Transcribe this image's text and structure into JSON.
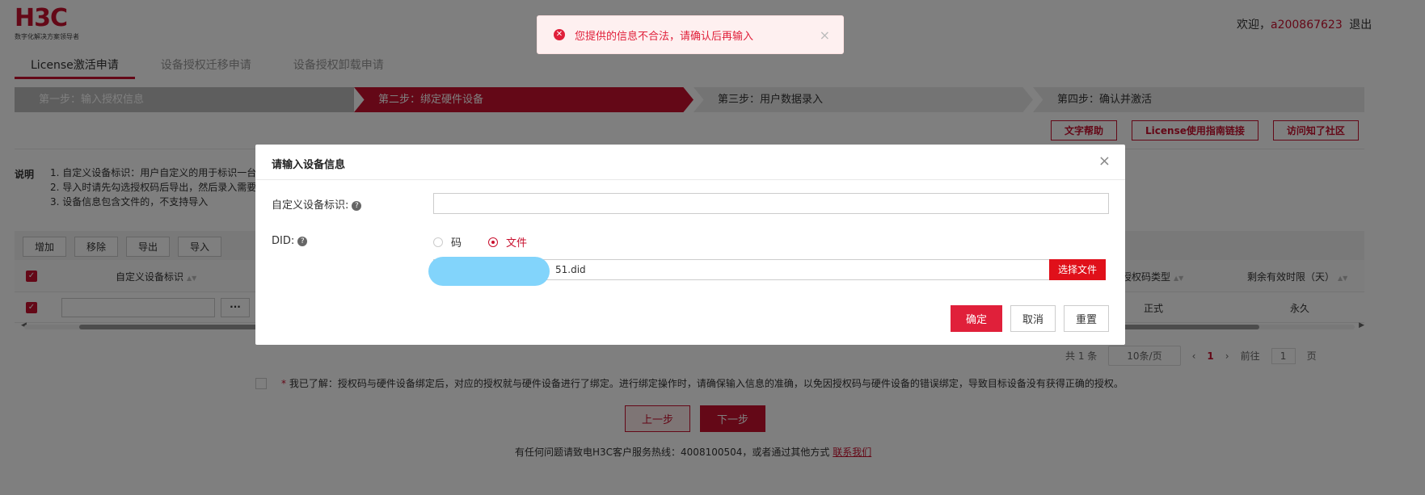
{
  "header": {
    "logo_text": "H3C",
    "logo_subtitle": "数字化解决方案领导者",
    "welcome_prefix": "欢迎，",
    "username": "a200867623",
    "logout": "退出"
  },
  "tabs": [
    {
      "label": "License激活申请",
      "active": true
    },
    {
      "label": "设备授权迁移申请",
      "active": false
    },
    {
      "label": "设备授权卸载申请",
      "active": false
    }
  ],
  "steps": [
    {
      "label": "第一步：输入授权信息"
    },
    {
      "label": "第二步：绑定硬件设备"
    },
    {
      "label": "第三步：用户数据录入"
    },
    {
      "label": "第四步：确认并激活"
    }
  ],
  "help_buttons": [
    "文字帮助",
    "License使用指南链接",
    "访问知了社区"
  ],
  "notes": {
    "label": "说明",
    "lines": [
      "1. 自定义设备标识：用户自定义的用于标识一台",
      "2. 导入时请先勾选授权码后导出，然后录入需要",
      "3. 设备信息包含文件的，不支持导入"
    ]
  },
  "toolbar": [
    "增加",
    "移除",
    "导出",
    "导入"
  ],
  "table": {
    "headers": {
      "custom_id": "自定义设备标识",
      "license_type": "授权码类型",
      "remaining": "剩余有效时限（天）"
    },
    "rows": [
      {
        "license_type": "正式",
        "remaining": "永久",
        "more": "···"
      }
    ]
  },
  "pagination": {
    "total": "共 1 条",
    "page_size": "10条/页",
    "prev": "‹",
    "current": "1",
    "next": "›",
    "goto_label": "前往",
    "goto_value": "1",
    "page_unit": "页"
  },
  "agreement": {
    "star": "*",
    "text": " 我已了解：授权码与硬件设备绑定后，对应的授权就与硬件设备进行了绑定。进行绑定操作时，请确保输入信息的准确，以免因授权码与硬件设备的错误绑定，导致目标设备没有获得正确的授权。"
  },
  "nav": {
    "prev": "上一步",
    "next": "下一步"
  },
  "footer": {
    "text": "有任何问题请致电H3C客户服务热线：4008100504，或者通过其他方式",
    "link": "联系我们"
  },
  "toast": {
    "message": "您提供的信息不合法，请确认后再输入",
    "close": "×"
  },
  "modal": {
    "title": "请输入设备信息",
    "close": "×",
    "custom_id_label": "自定义设备标识:",
    "did_label": "DID:",
    "help_glyph": "?",
    "custom_id_value": "",
    "radio_code": "码",
    "radio_file": "文件",
    "file_name": "51.did",
    "choose_file": "选择文件",
    "ok": "确定",
    "cancel": "取消",
    "reset": "重置"
  },
  "colors": {
    "brand": "#c8102e",
    "error": "#e0203a",
    "redacted_blob": "#82d4fb"
  }
}
